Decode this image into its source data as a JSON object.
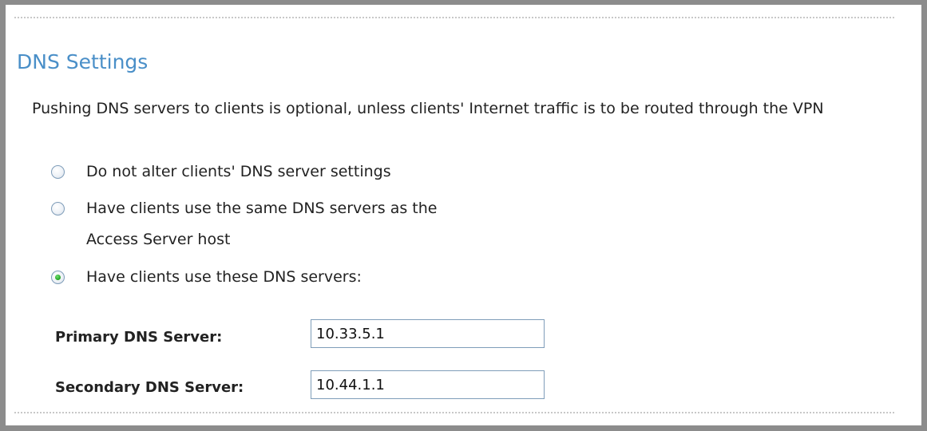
{
  "section": {
    "title": "DNS Settings",
    "description": "Pushing DNS servers to clients is optional, unless clients' Internet traffic is to be routed through the VPN"
  },
  "dns_options": [
    {
      "label": "Do not alter clients' DNS server settings",
      "selected": false
    },
    {
      "label": "Have clients use the same DNS servers as the\nAccess Server host",
      "selected": false
    },
    {
      "label": "Have clients use these DNS servers:",
      "selected": true
    }
  ],
  "fields": {
    "primary": {
      "label": "Primary DNS Server:",
      "value": "10.33.5.1"
    },
    "secondary": {
      "label": "Secondary DNS Server:",
      "value": "10.44.1.1"
    }
  },
  "colors": {
    "title": "#4a8fc8",
    "frame": "#8c8c8c",
    "radio_dot": "#22a022"
  }
}
